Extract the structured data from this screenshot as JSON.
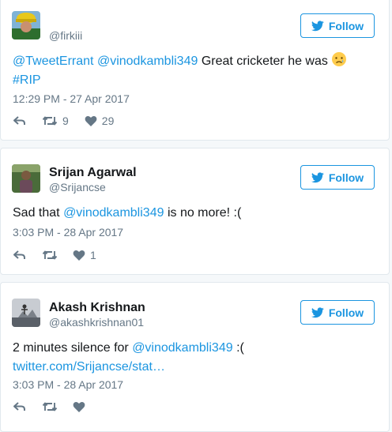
{
  "colors": {
    "link": "#1b95e0",
    "muted": "#657786",
    "border": "#e1e8ed",
    "background": "#f5f8fa"
  },
  "tweets": [
    {
      "name": "",
      "handle": "@firkiii",
      "follow_label": "Follow",
      "mention_1": "@TweetErrant",
      "mention_2": "@vinodkambli349",
      "text_1": "Great cricketer he was",
      "emoji": "crying-face-emoji",
      "hashtag": "#RIP",
      "timestamp": "12:29 PM - 27 Apr 2017",
      "retweet_count": "9",
      "like_count": "29"
    },
    {
      "name": "Srijan Agarwal",
      "handle": "@Srijancse",
      "follow_label": "Follow",
      "text_1": "Sad that",
      "mention_1": "@vinodkambli349",
      "text_2": "is no more! :(",
      "timestamp": "3:03 PM - 28 Apr 2017",
      "retweet_count": "",
      "like_count": "1"
    },
    {
      "name": "Akash Krishnan",
      "handle": "@akashkrishnan01",
      "follow_label": "Follow",
      "text_1": "2 minutes silence for",
      "mention_1": "@vinodkambli349",
      "text_2": ":(",
      "link": "twitter.com/Srijancse/stat…",
      "timestamp": "3:03 PM - 28 Apr 2017",
      "retweet_count": "",
      "like_count": ""
    }
  ],
  "icons": {
    "reply": "reply-icon",
    "retweet": "retweet-icon",
    "like": "heart-icon",
    "bird": "twitter-bird-icon"
  }
}
